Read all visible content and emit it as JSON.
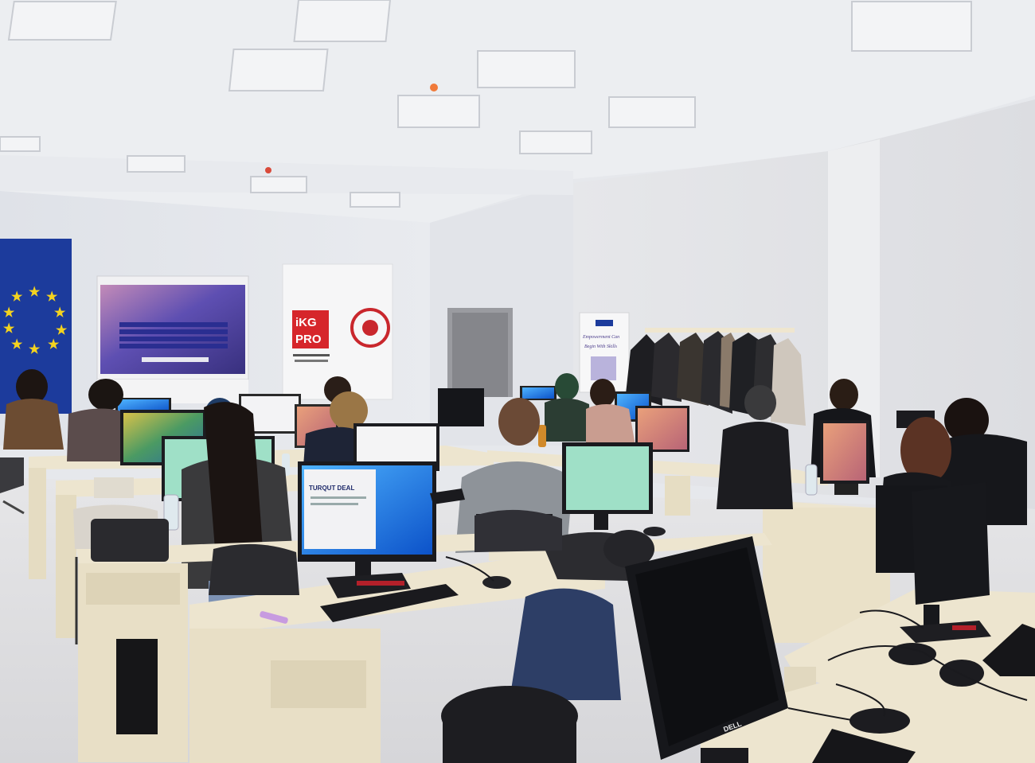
{
  "banner_ikg": {
    "logo_line1": "iKG",
    "logo_line2": "PRO"
  },
  "banner_project": {
    "line1": "Empowerment Can",
    "line2": "Begin With Skills"
  },
  "screen_word": {
    "title": "TURQUT DEAL"
  },
  "monitor_brand": "DELL",
  "colors": {
    "wall": "#e4e6eb",
    "ceiling": "#eef0f3",
    "floor": "#dfe0e3",
    "desk": "#ede5cf",
    "eu_blue": "#1c3b9c",
    "ikg_red": "#d6262b",
    "win_blue": "#1e6fd9",
    "spreadsheet": "#9fe0c7"
  }
}
